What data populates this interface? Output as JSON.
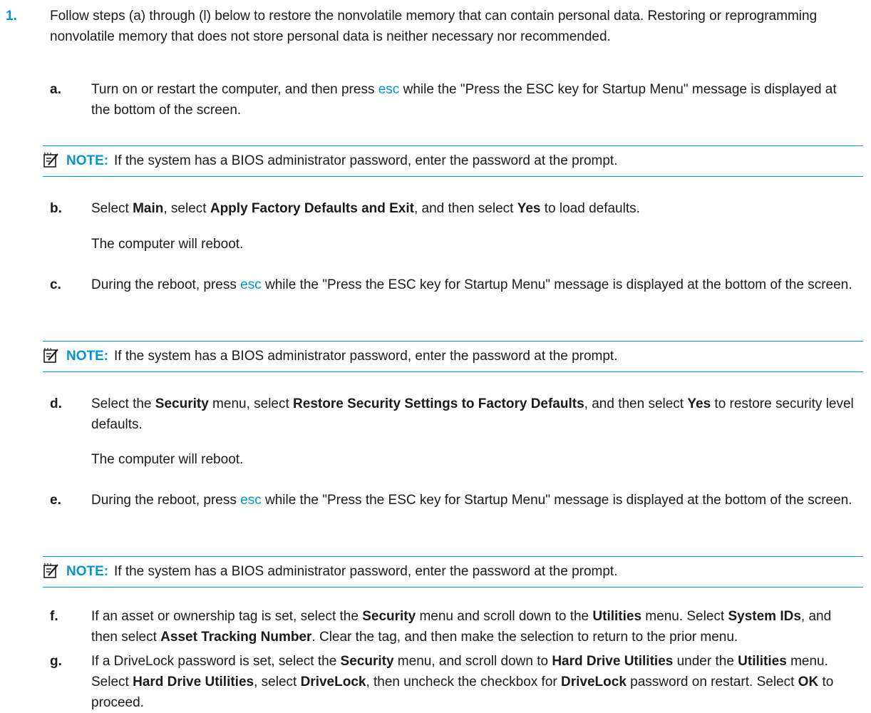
{
  "step": {
    "number": "1.",
    "text": "Follow steps (a) through (l) below to restore the nonvolatile memory that can contain personal data. Restoring or reprogramming nonvolatile memory that does not store personal data is neither necessary nor recommended."
  },
  "note": {
    "label": "NOTE:",
    "text": "If the system has a BIOS administrator password, enter the password at the prompt.",
    "icon": "note-icon"
  },
  "key_label": "esc",
  "reboot_text": "The computer will reboot.",
  "steps": {
    "a": {
      "letter": "a.",
      "t1": "Turn on or restart the computer, and then press ",
      "t2": " while the \"Press the ESC key for Startup Menu\" message is displayed at the bottom of the screen."
    },
    "b": {
      "letter": "b.",
      "t1": "Select ",
      "b1": "Main",
      "t2": ", select ",
      "b2": "Apply Factory Defaults and Exit",
      "t3": ", and then select ",
      "b3": "Yes",
      "t4": " to load defaults."
    },
    "c": {
      "letter": "c.",
      "t1": "During the reboot, press ",
      "t2": " while the \"Press the ESC key for Startup Menu\" message is displayed at the bottom of the screen."
    },
    "d": {
      "letter": "d.",
      "t1": "Select the ",
      "b1": "Security",
      "t2": " menu, select ",
      "b2": "Restore Security Settings to Factory Defaults",
      "t3": ", and then select ",
      "b3": "Yes",
      "t4": " to restore security level defaults."
    },
    "e": {
      "letter": "e.",
      "t1": "During the reboot, press ",
      "t2": " while the \"Press the ESC key for Startup Menu\" message is displayed at the bottom of the screen."
    },
    "f": {
      "letter": "f.",
      "t1": "If an asset or ownership tag is set, select the ",
      "b1": "Security",
      "t2": " menu and scroll down to the ",
      "b2": "Utilities",
      "t3": " menu. Select ",
      "b3": "System IDs",
      "t4": ", and then select ",
      "b4": "Asset Tracking Number",
      "t5": ". Clear the tag, and then make the selection to return to the prior menu."
    },
    "g": {
      "letter": "g.",
      "t1": "If a DriveLock password is set, select the ",
      "b1": "Security",
      "t2": " menu, and scroll down to ",
      "b2": "Hard Drive Utilities",
      "t3": " under the ",
      "b3": "Utilities",
      "t4": " menu. Select ",
      "b4": "Hard Drive Utilities",
      "t5": ", select ",
      "b5": "DriveLock",
      "t6": ", then uncheck the checkbox for ",
      "b6": "DriveLock",
      "t7": " password on restart. Select ",
      "b7": "OK",
      "t8": " to proceed."
    }
  }
}
